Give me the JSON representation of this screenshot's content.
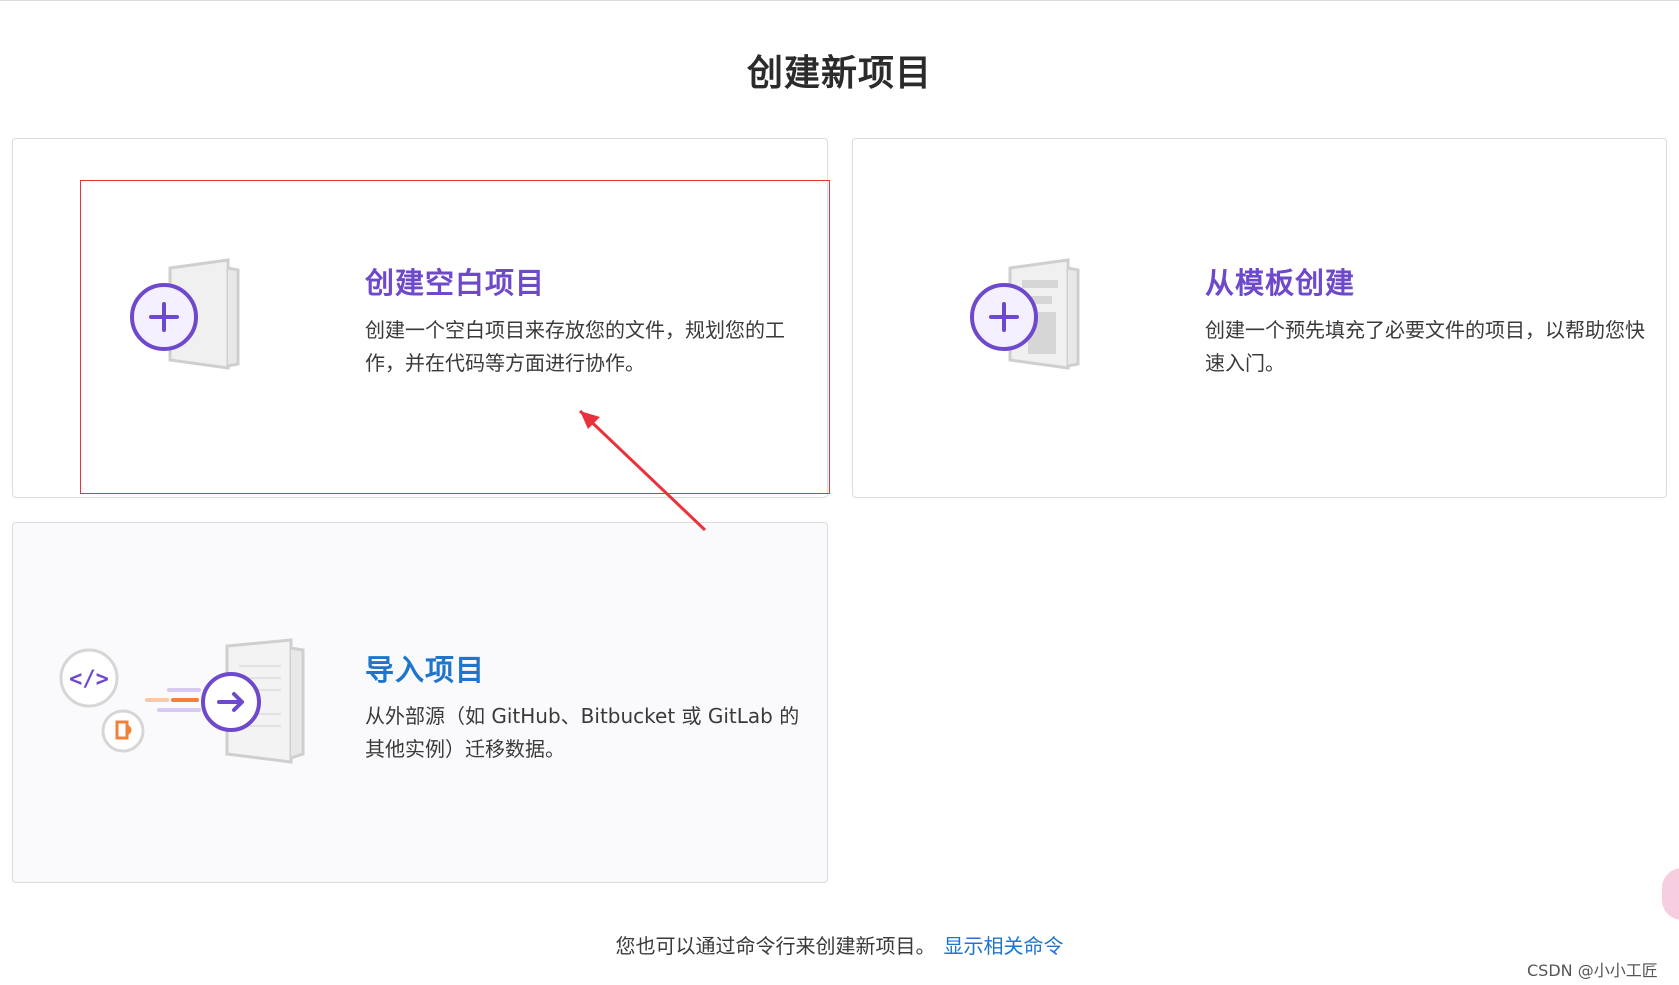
{
  "page": {
    "title": "创建新项目"
  },
  "cards": {
    "blank": {
      "title": "创建空白项目",
      "description": "创建一个空白项目来存放您的文件，规划您的工作，并在代码等方面进行协作。",
      "icon": "blank-project-icon"
    },
    "template": {
      "title": "从模板创建",
      "description": "创建一个预先填充了必要文件的项目，以帮助您快速入门。",
      "icon": "template-project-icon"
    },
    "import": {
      "title": "导入项目",
      "description": "从外部源（如 GitHub、Bitbucket 或 GitLab 的其他实例）迁移数据。",
      "icon": "import-project-icon"
    }
  },
  "footer": {
    "text": "您也可以通过命令行来创建新项目。",
    "link": "显示相关命令"
  },
  "watermark": {
    "text": "CSDN @小小工匠"
  },
  "colors": {
    "accent_purple": "#6e49cb",
    "accent_blue": "#1f75cb",
    "annotation_red": "#e8323c"
  }
}
